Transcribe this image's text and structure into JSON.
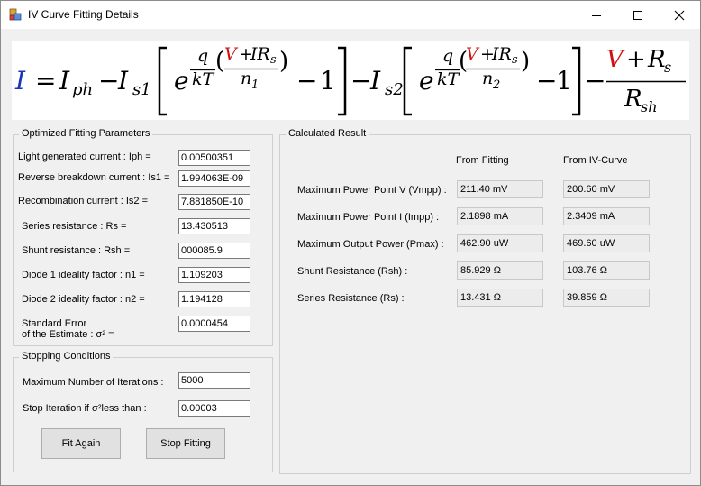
{
  "window": {
    "title": "IV Curve Fitting Details"
  },
  "formula": {
    "I": "I",
    "eq": "=",
    "Iph": "I",
    "ph": "ph",
    "minus": "−",
    "Is1": "I",
    "s1": "s1",
    "Is2": "I",
    "s2": "s2",
    "e": "e",
    "q": "q",
    "kT": "kT",
    "open_paren": "(",
    "close_paren": ")",
    "V": "V",
    "plus": "+",
    "IRs": "IR",
    "s": "s",
    "n1": "n",
    "n1sub": "1",
    "n2": "n",
    "n2sub": "2",
    "one": "1",
    "Rs_num": "R",
    "Rs_sub": "s",
    "Rsh": "R",
    "sh": "sh"
  },
  "optimized": {
    "title": "Optimized Fitting Parameters",
    "fields": [
      {
        "label": "Light generated current : Iph =",
        "value": "0.00500351"
      },
      {
        "label": "Reverse breakdown current : Is1 =",
        "value": "1.994063E-09"
      },
      {
        "label": "Recombination current : Is2 =",
        "value": "7.881850E-10"
      },
      {
        "label": "Series resistance : Rs =",
        "value": "13.430513"
      },
      {
        "label": "Shunt resistance : Rsh =",
        "value": "000085.9"
      },
      {
        "label": "Diode 1 ideality factor : n1 =",
        "value": "1.109203"
      },
      {
        "label": "Diode 2 ideality factor : n2 =",
        "value": "1.194128"
      }
    ],
    "std_error": {
      "label_line1": "Standard Error",
      "label_line2": "of the Estimate : σ² =",
      "value": "0.0000454"
    }
  },
  "stopping": {
    "title": "Stopping Conditions",
    "max_iter_label": "Maximum Number of Iterations :",
    "max_iter_value": "5000",
    "stop_label": "Stop Iteration if σ²less than :",
    "stop_value": "0.00003"
  },
  "buttons": {
    "fit_again": "Fit Again",
    "stop_fitting": "Stop Fitting"
  },
  "result": {
    "title": "Calculated Result",
    "col_fitting": "From Fitting",
    "col_curve": "From IV-Curve",
    "rows": [
      {
        "label": "Maximum Power Point V (Vmpp) :",
        "fitting": "211.40 mV",
        "curve": "200.60 mV"
      },
      {
        "label": "Maximum Power Point I (Impp) :",
        "fitting": "2.1898 mA",
        "curve": "2.3409 mA"
      },
      {
        "label": "Maximum Output Power (Pmax) :",
        "fitting": "462.90 uW",
        "curve": "469.60 uW"
      },
      {
        "label": "Shunt Resistance  (Rsh) :",
        "fitting": "85.929 Ω",
        "curve": "103.76 Ω"
      },
      {
        "label": "Series Resistance  (Rs) :",
        "fitting": "13.431 Ω",
        "curve": "39.859 Ω"
      }
    ]
  }
}
